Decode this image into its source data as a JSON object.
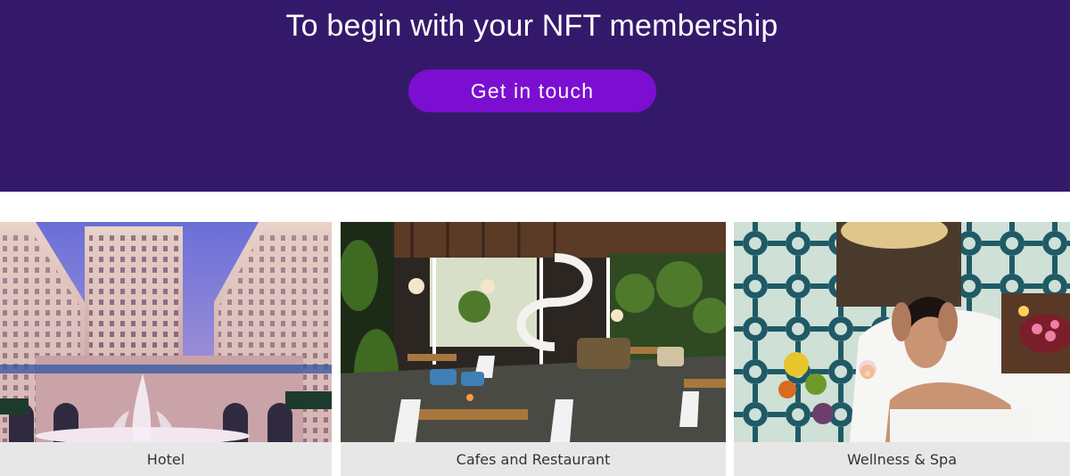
{
  "hero": {
    "title": "To begin with your NFT membership",
    "cta_label": "Get in touch",
    "background_color": "#34196a",
    "cta_color": "#7c0ed2"
  },
  "categories": [
    {
      "label": "Hotel",
      "image": "hotel-courtyard-photo"
    },
    {
      "label": "Cafes and Restaurant",
      "image": "cafe-interior-photo"
    },
    {
      "label": "Wellness & Spa",
      "image": "spa-massage-photo"
    }
  ]
}
